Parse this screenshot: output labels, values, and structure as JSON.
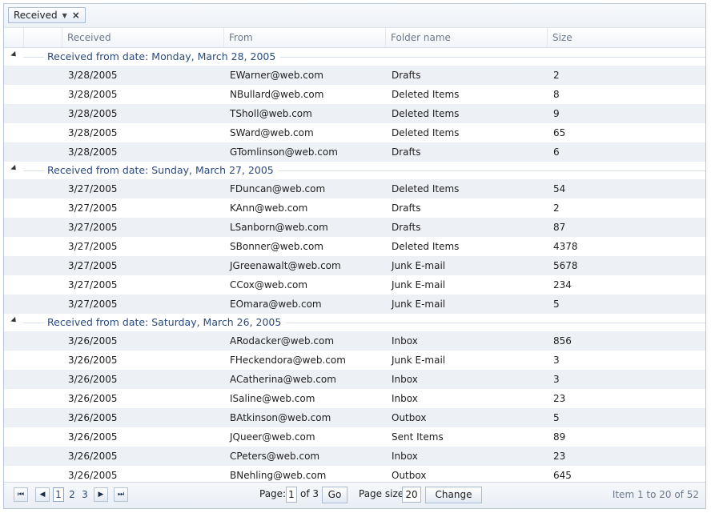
{
  "group_panel": {
    "chip_label": "Received"
  },
  "columns": [
    "Received",
    "From",
    "Folder name",
    "Size"
  ],
  "groups": [
    {
      "title": "Received from date: Monday, March 28, 2005",
      "rows": [
        {
          "received": "3/28/2005",
          "from": "EWarner@web.com",
          "folder": "Drafts",
          "size": "2"
        },
        {
          "received": "3/28/2005",
          "from": "NBullard@web.com",
          "folder": "Deleted Items",
          "size": "8"
        },
        {
          "received": "3/28/2005",
          "from": "TSholl@web.com",
          "folder": "Deleted Items",
          "size": "9"
        },
        {
          "received": "3/28/2005",
          "from": "SWard@web.com",
          "folder": "Deleted Items",
          "size": "65"
        },
        {
          "received": "3/28/2005",
          "from": "GTomlinson@web.com",
          "folder": "Drafts",
          "size": "6"
        }
      ]
    },
    {
      "title": "Received from date: Sunday, March 27, 2005",
      "rows": [
        {
          "received": "3/27/2005",
          "from": "FDuncan@web.com",
          "folder": "Deleted Items",
          "size": "54"
        },
        {
          "received": "3/27/2005",
          "from": "KAnn@web.com",
          "folder": "Drafts",
          "size": "2"
        },
        {
          "received": "3/27/2005",
          "from": "LSanborn@web.com",
          "folder": "Drafts",
          "size": "87"
        },
        {
          "received": "3/27/2005",
          "from": "SBonner@web.com",
          "folder": "Deleted Items",
          "size": "4378"
        },
        {
          "received": "3/27/2005",
          "from": "JGreenawalt@web.com",
          "folder": "Junk E-mail",
          "size": "5678"
        },
        {
          "received": "3/27/2005",
          "from": "CCox@web.com",
          "folder": "Junk E-mail",
          "size": "234"
        },
        {
          "received": "3/27/2005",
          "from": "EOmara@web.com",
          "folder": "Junk E-mail",
          "size": "5"
        }
      ]
    },
    {
      "title": "Received from date: Saturday, March 26, 2005",
      "rows": [
        {
          "received": "3/26/2005",
          "from": "ARodacker@web.com",
          "folder": "Inbox",
          "size": "856"
        },
        {
          "received": "3/26/2005",
          "from": "FHeckendora@web.com",
          "folder": "Junk E-mail",
          "size": "3"
        },
        {
          "received": "3/26/2005",
          "from": "ACatherina@web.com",
          "folder": "Inbox",
          "size": "3"
        },
        {
          "received": "3/26/2005",
          "from": "ISaline@web.com",
          "folder": "Inbox",
          "size": "23"
        },
        {
          "received": "3/26/2005",
          "from": "BAtkinson@web.com",
          "folder": "Outbox",
          "size": "5"
        },
        {
          "received": "3/26/2005",
          "from": "JQueer@web.com",
          "folder": "Sent Items",
          "size": "89"
        },
        {
          "received": "3/26/2005",
          "from": "CPeters@web.com",
          "folder": "Inbox",
          "size": "23"
        },
        {
          "received": "3/26/2005",
          "from": "BNehling@web.com",
          "folder": "Outbox",
          "size": "645"
        }
      ]
    }
  ],
  "pager": {
    "pages": [
      "1",
      "2",
      "3"
    ],
    "current_page": "1",
    "page_label": "Page:",
    "page_value": "1",
    "of_text": "of 3",
    "go_label": "Go",
    "page_size_label": "Page size:",
    "page_size_value": "20",
    "change_label": "Change",
    "info": "Item 1 to 20 of 52"
  }
}
